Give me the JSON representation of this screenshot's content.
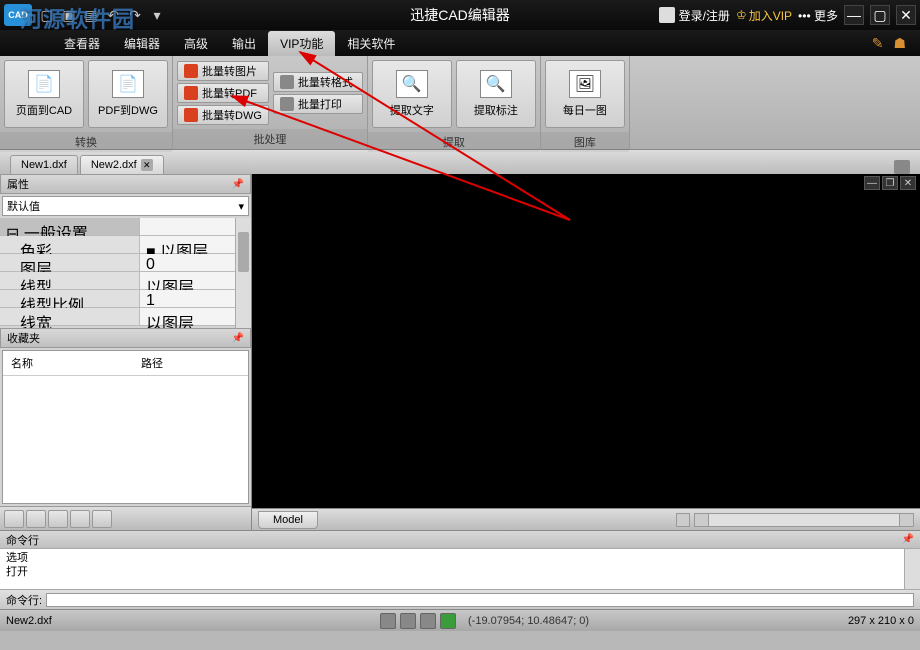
{
  "title": "迅捷CAD编辑器",
  "watermark": "河源软件园",
  "titlebar": {
    "login": "登录/注册",
    "vip": "加入VIP",
    "more": "更多"
  },
  "menu": {
    "items": [
      "查看器",
      "编辑器",
      "高级",
      "输出",
      "VIP功能",
      "相关软件"
    ],
    "active_index": 4
  },
  "ribbon": {
    "groups": [
      {
        "label": "转换",
        "big": [
          {
            "label": "页面到CAD"
          },
          {
            "label": "PDF到DWG"
          }
        ]
      },
      {
        "label": "批处理",
        "small_col1": [
          {
            "label": "批量转图片"
          },
          {
            "label": "批量转PDF"
          },
          {
            "label": "批量转DWG"
          }
        ],
        "small_col2": [
          {
            "label": "批量转格式"
          },
          {
            "label": "批量打印"
          }
        ]
      },
      {
        "label": "提取",
        "big": [
          {
            "label": "提取文字"
          },
          {
            "label": "提取标注"
          }
        ]
      },
      {
        "label": "图库",
        "big": [
          {
            "label": "每日一图"
          }
        ]
      }
    ]
  },
  "tabs": {
    "items": [
      "New1.dxf",
      "New2.dxf"
    ],
    "active_index": 1
  },
  "props": {
    "panel_title": "属性",
    "dropdown": "默认值",
    "section": "一般设置",
    "rows": [
      {
        "k": "色彩",
        "v": "■ 以图层"
      },
      {
        "k": "图层",
        "v": "0"
      },
      {
        "k": "线型",
        "v": "以图层"
      },
      {
        "k": "线型比例",
        "v": "1"
      },
      {
        "k": "线宽",
        "v": "以图层"
      }
    ]
  },
  "fav": {
    "title": "收藏夹",
    "col1": "名称",
    "col2": "路径"
  },
  "model": {
    "tab": "Model"
  },
  "cmd": {
    "title": "命令行",
    "line1": "选项",
    "line2": "打开",
    "prompt": "命令行:"
  },
  "status": {
    "file": "New2.dxf",
    "coords": "(-19.07954; 10.48647; 0)",
    "dims": "297 x 210 x 0"
  }
}
